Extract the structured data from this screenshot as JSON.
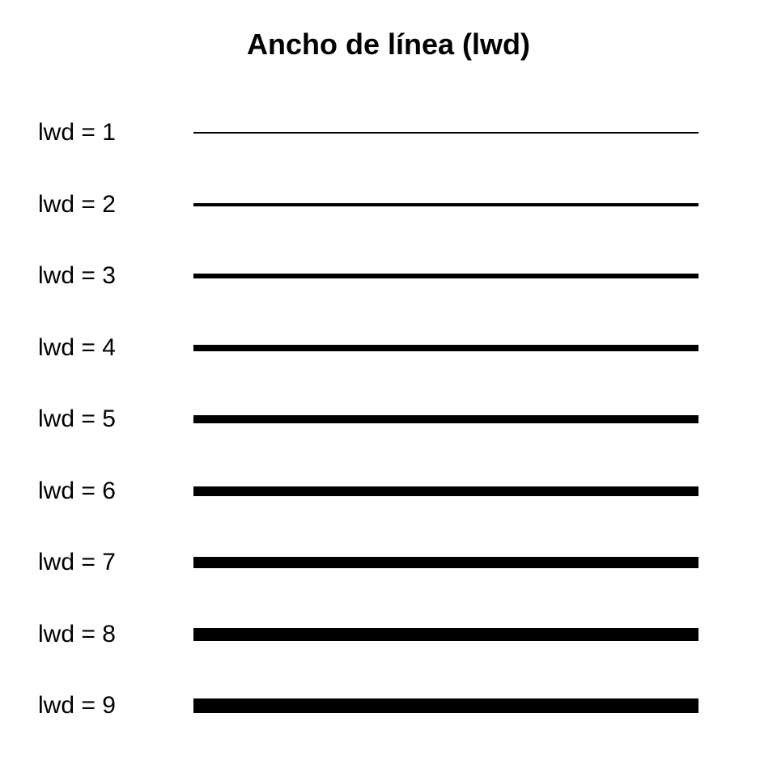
{
  "title": "Ancho de línea (lwd)",
  "line_color": "#000000",
  "rows": [
    {
      "label": "lwd = 1",
      "lwd": 1
    },
    {
      "label": "lwd = 2",
      "lwd": 2
    },
    {
      "label": "lwd = 3",
      "lwd": 3
    },
    {
      "label": "lwd = 4",
      "lwd": 4
    },
    {
      "label": "lwd = 5",
      "lwd": 5
    },
    {
      "label": "lwd = 6",
      "lwd": 6
    },
    {
      "label": "lwd = 7",
      "lwd": 7
    },
    {
      "label": "lwd = 8",
      "lwd": 8
    },
    {
      "label": "lwd = 9",
      "lwd": 9
    }
  ]
}
